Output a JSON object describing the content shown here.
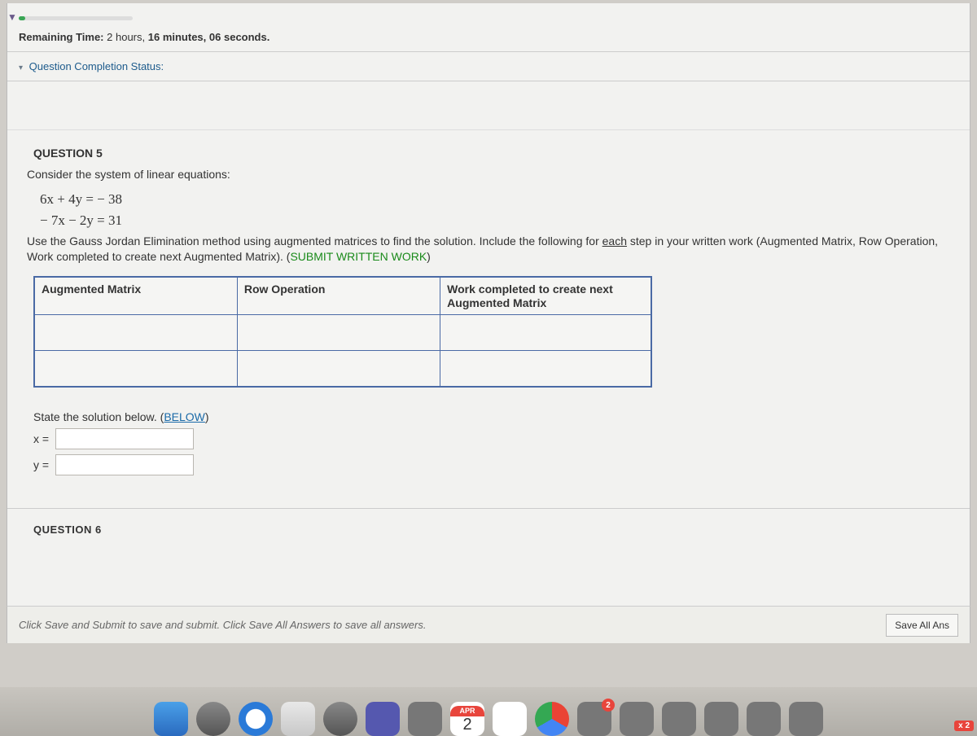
{
  "timer": {
    "label_prefix": "Remaining Time:",
    "hours": "2 hours,",
    "minutes": "16 minutes,",
    "seconds": "06 seconds."
  },
  "completion": {
    "label": "Question Completion Status:"
  },
  "q5": {
    "header": "QUESTION 5",
    "intro": "Consider the system of linear equations:",
    "eq1": "6x + 4y =  − 38",
    "eq2": "− 7x − 2y =     31",
    "method_pre": "Use the Gauss Jordan Elimination method using augmented matrices to find the solution.  Include the following for ",
    "method_each": "each",
    "method_mid": " step in your written work (Augmented Matrix, Row Operation, Work completed to create next Augmented Matrix).  (",
    "submit_text": "SUBMIT WRITTEN WORK",
    "method_post": ")",
    "table": {
      "h1": "Augmented Matrix",
      "h2": "Row Operation",
      "h3": "Work completed to create next Augmented Matrix"
    },
    "state_pre": "State the solution below.  (",
    "below": "BELOW",
    "state_post": ")",
    "x_label": "x =",
    "y_label": "y ="
  },
  "q6": {
    "header": "QUESTION 6"
  },
  "footer": {
    "hint": "Click Save and Submit to save and submit. Click Save All Answers to save all answers.",
    "save_all": "Save All Ans"
  },
  "dock": {
    "cal_month": "APR",
    "cal_day": "2",
    "badge2": "2",
    "xbadge": "2"
  }
}
